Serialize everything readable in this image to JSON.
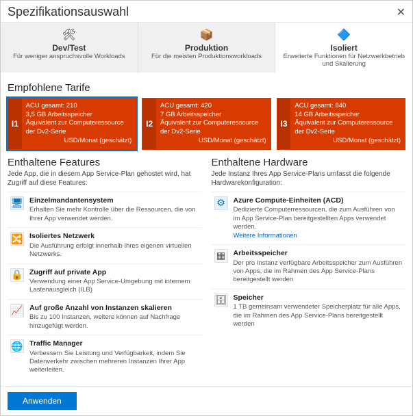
{
  "header": {
    "title": "Spezifikationsauswahl"
  },
  "tabs": [
    {
      "icon": "🛠",
      "title": "Dev/Test",
      "sub": "Für weniger anspruchsvolle Workloads"
    },
    {
      "icon": "📦",
      "title": "Produktion",
      "sub": "Für die meisten Produktionsworkloads"
    },
    {
      "icon": "🔷",
      "title": "Isoliert",
      "sub": "Erweiterte Funktionen für Netzwerkbetrieb und Skalierung"
    }
  ],
  "selectedTab": 2,
  "recommended_title": "Empfohlene Tarife",
  "tiers": [
    {
      "code": "I1",
      "l1": "ACU gesamt: 210",
      "l2": "3,5 GB Arbeitsspeicher",
      "l3": "Äquivalent zur Computeressource der Dv2-Serie",
      "l4": "USD/Monat (geschätzt)"
    },
    {
      "code": "I2",
      "l1": "ACU gesamt: 420",
      "l2": "7 GB Arbeitsspeicher",
      "l3": "Äquivalent zur Computeressource der Dv2-Serie",
      "l4": "USD/Monat (geschätzt)"
    },
    {
      "code": "I3",
      "l1": "ACU gesamt: 840",
      "l2": "14 GB Arbeitsspeicher",
      "l3": "Äquivalent zur Computeressource der Dv2-Serie",
      "l4": "USD/Monat (geschätzt)"
    }
  ],
  "selectedTier": 0,
  "features": {
    "title": "Enthaltene Features",
    "sub": "Jede App, die in diesem App Service-Plan gehostet wird, hat Zugriff auf diese Features:",
    "items": [
      {
        "icon": "🖥",
        "title": "Einzelmandantensystem",
        "desc": "Erhalten Sie mehr Kontrolle über die Ressourcen, die von Ihrer App verwendet werden."
      },
      {
        "icon": "🔀",
        "title": "Isoliertes Netzwerk",
        "desc": "Die Ausführung erfolgt innerhalb Ihres eigenen virtuellen Netzwerks."
      },
      {
        "icon": "🔒",
        "title": "Zugriff auf private App",
        "desc": "Verwendung einer App Service-Umgebung mit internem Lastenausgleich (ILB)"
      },
      {
        "icon": "📈",
        "title": "Auf große Anzahl von Instanzen skalieren",
        "desc": "Bis zu 100 Instanzen, weitere können auf Nachfrage hinzugefügt werden."
      },
      {
        "icon": "🌐",
        "title": "Traffic Manager",
        "desc": "Verbessern Sie Leistung und Verfügbarkeit, indem Sie Datenverkehr zwischen mehreren Instanzen Ihrer App weiterleiten."
      }
    ]
  },
  "hardware": {
    "title": "Enthaltene Hardware",
    "sub": "Jede Instanz Ihres App Service-Plans umfasst die folgende Hardwarekonfiguration:",
    "items": [
      {
        "icon": "⚙",
        "title": "Azure Compute-Einheiten (ACD)",
        "desc": "Dedizierte Computerressourcen, die zum Ausführen von im App Service-Plan bereitgestellten Apps verwendet werden.",
        "link": "Weitere Informationen"
      },
      {
        "icon": "▦",
        "title": "Arbeitsspeicher",
        "desc": "Der pro Instanz verfügbare Arbeitsspeicher zum Ausführen von Apps, die im Rahmen des App Service-Plans bereitgestellt werden"
      },
      {
        "icon": "🗄",
        "title": "Speicher",
        "desc": "1 TB gemeinsam verwendeter Speicherplatz für alle Apps, die im Rahmen des App Service-Plans bereitgestellt werden"
      }
    ]
  },
  "footer": {
    "apply": "Anwenden"
  }
}
